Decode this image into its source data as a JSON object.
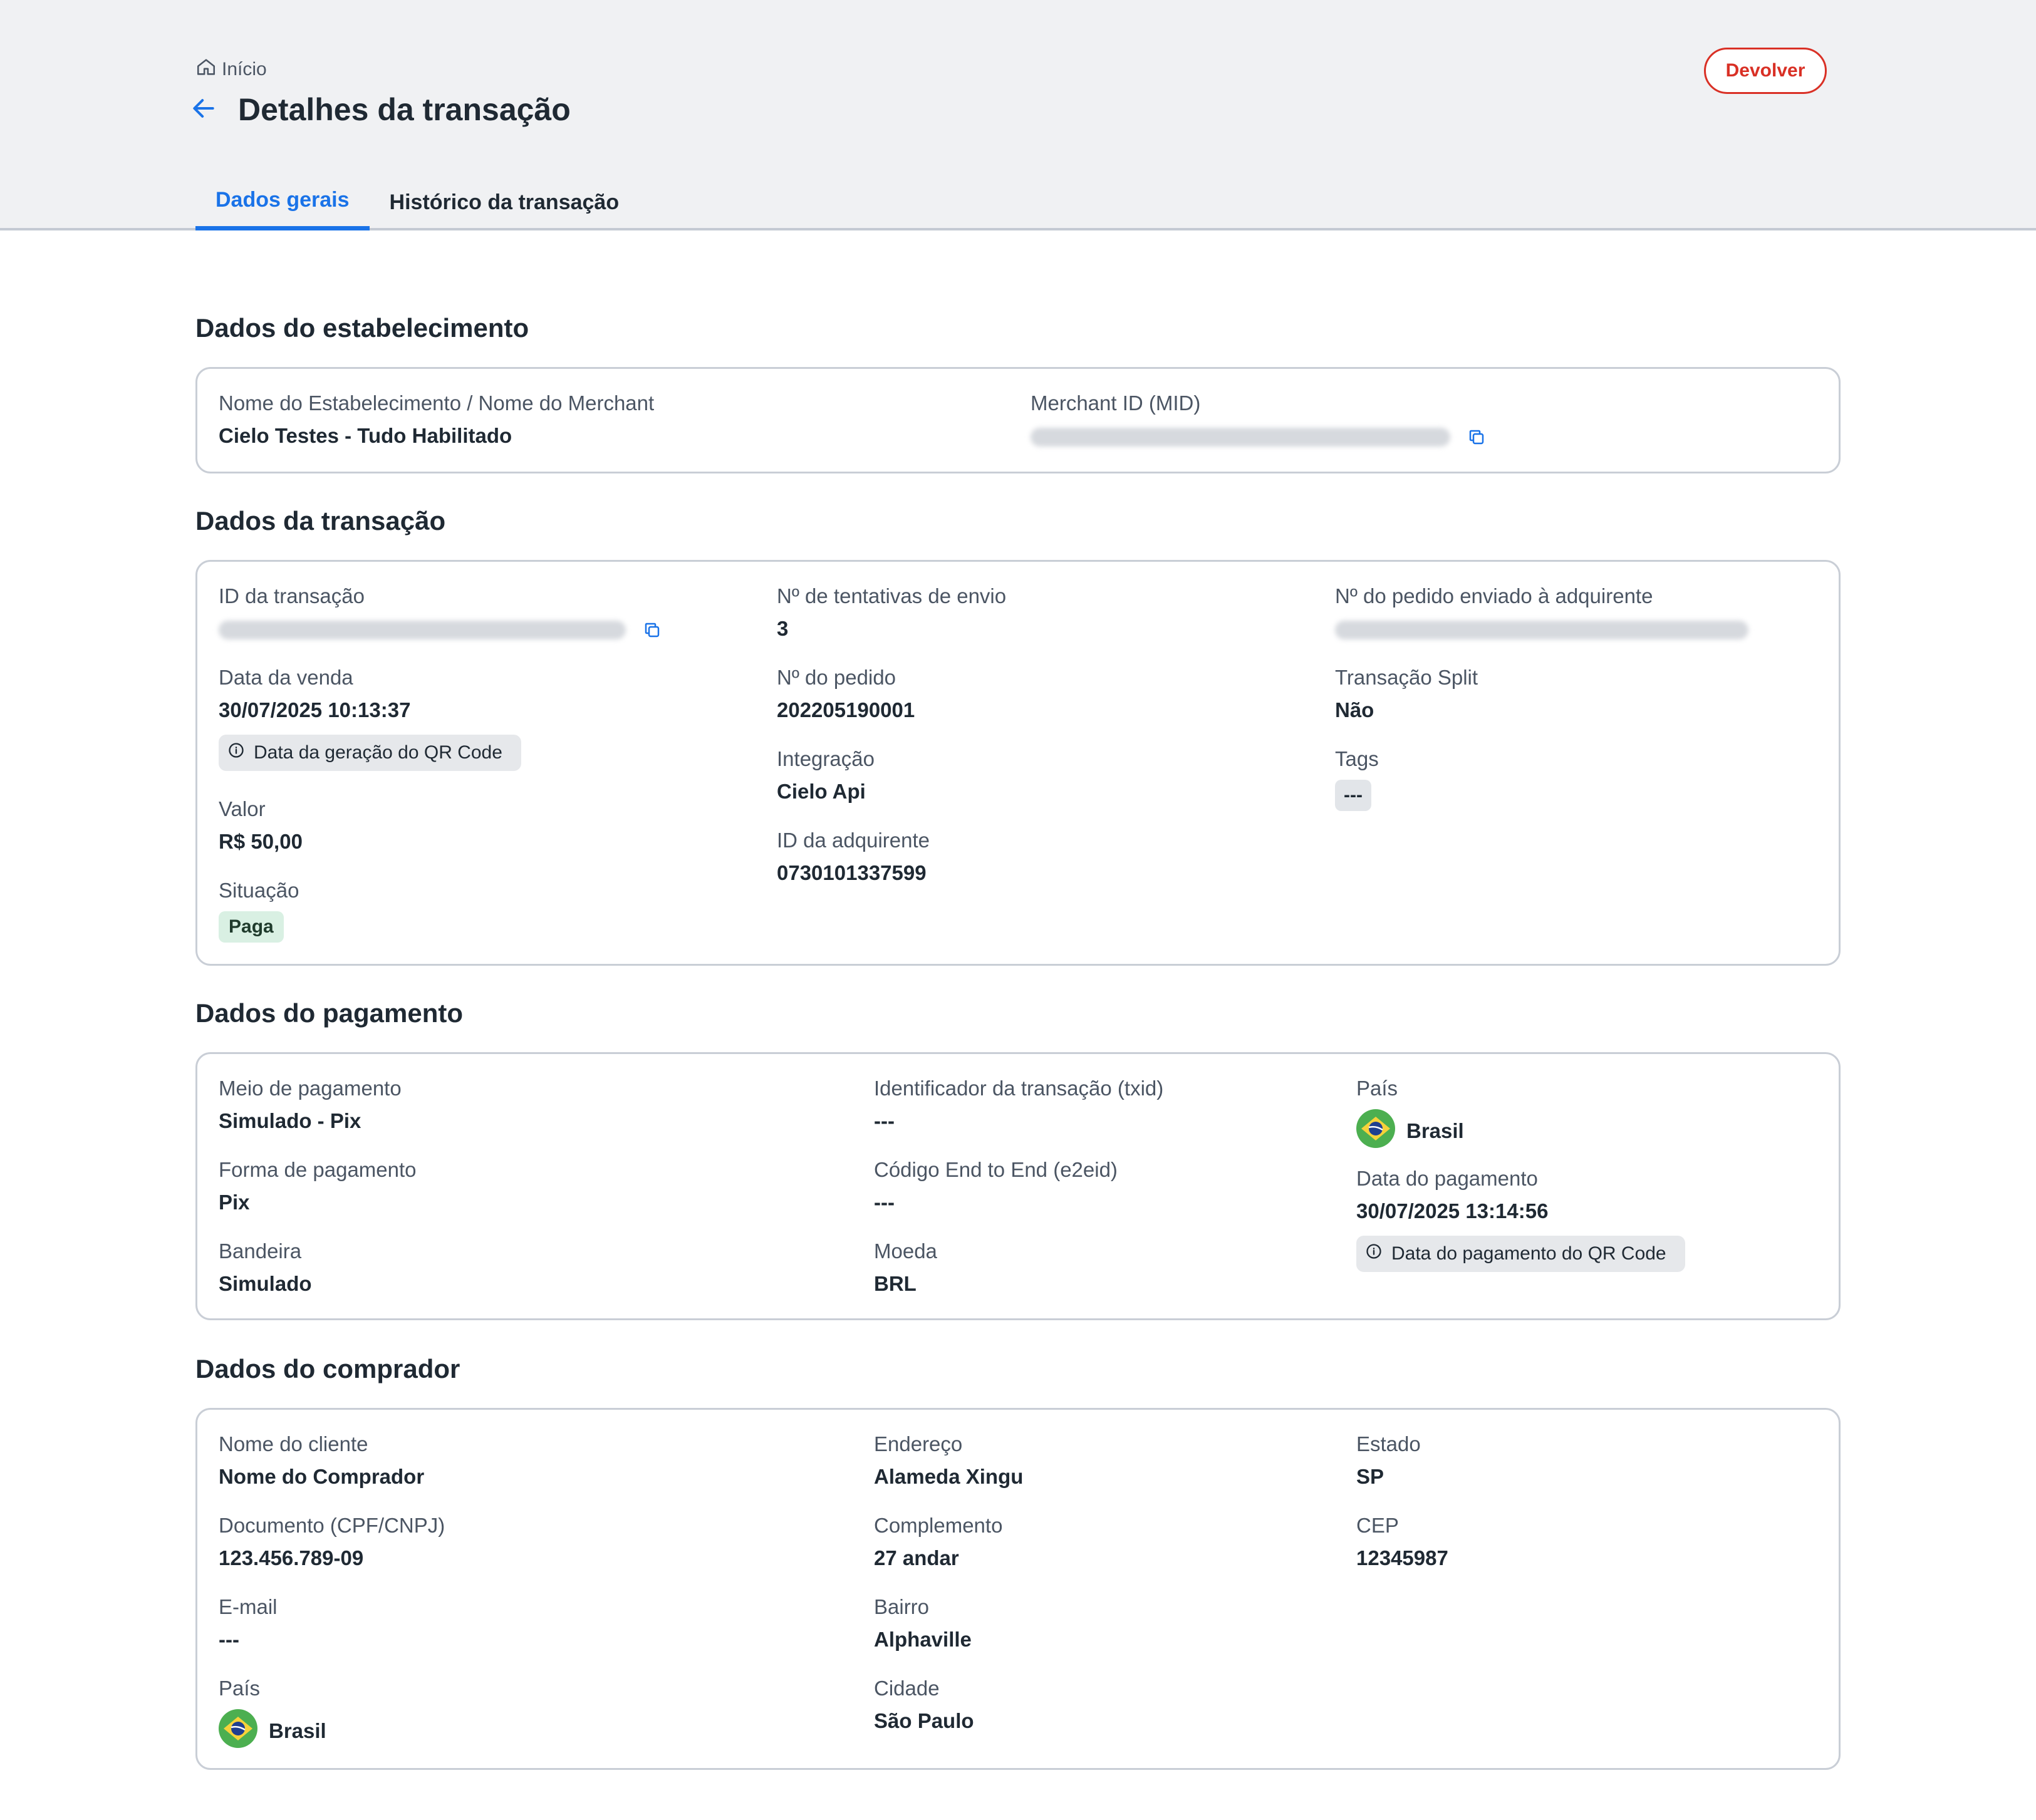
{
  "header": {
    "breadcrumb": "Início",
    "title": "Detalhes da transação",
    "devolver_label": "Devolver"
  },
  "tabs": [
    {
      "label": "Dados gerais",
      "active": true
    },
    {
      "label": "Histórico da transação",
      "active": false
    }
  ],
  "establishment": {
    "section_title": "Dados do estabelecimento",
    "name_label": "Nome do Estabelecimento / Nome do Merchant",
    "name_value": "Cielo Testes - Tudo Habilitado",
    "mid_label": "Merchant ID (MID)"
  },
  "transaction": {
    "section_title": "Dados da transação",
    "id_label": "ID da transação",
    "date_label": "Data da venda",
    "date_value": "30/07/2025 10:13:37",
    "date_chip": "Data da geração do QR Code",
    "valor_label": "Valor",
    "valor_value": "R$ 50,00",
    "situacao_label": "Situação",
    "situacao_value": "Paga",
    "tentativas_label": "Nº de tentativas de envio",
    "tentativas_value": "3",
    "pedido_label": "Nº do pedido",
    "pedido_value": "202205190001",
    "integracao_label": "Integração",
    "integracao_value": "Cielo Api",
    "adquirente_id_label": "ID da adquirente",
    "adquirente_id_value": "0730101337599",
    "pedido_adquirente_label": "Nº do pedido enviado à adquirente",
    "split_label": "Transação Split",
    "split_value": "Não",
    "tags_label": "Tags",
    "tags_value": "---"
  },
  "payment": {
    "section_title": "Dados do pagamento",
    "meio_label": "Meio de pagamento",
    "meio_value": "Simulado - Pix",
    "forma_label": "Forma de pagamento",
    "forma_value": "Pix",
    "bandeira_label": "Bandeira",
    "bandeira_value": "Simulado",
    "txid_label": "Identificador da transação (txid)",
    "txid_value": "---",
    "e2eid_label": "Código End to End (e2eid)",
    "e2eid_value": "---",
    "moeda_label": "Moeda",
    "moeda_value": "BRL",
    "pais_label": "País",
    "pais_value": "Brasil",
    "data_label": "Data do pagamento",
    "data_value": "30/07/2025 13:14:56",
    "data_chip": "Data do pagamento do QR Code"
  },
  "buyer": {
    "section_title": "Dados do comprador",
    "nome_label": "Nome do cliente",
    "nome_value": "Nome do Comprador",
    "documento_label": "Documento (CPF/CNPJ)",
    "documento_value": "123.456.789-09",
    "email_label": "E-mail",
    "email_value": "---",
    "pais_label": "País",
    "pais_value": "Brasil",
    "endereco_label": "Endereço",
    "endereco_value": "Alameda Xingu",
    "complemento_label": "Complemento",
    "complemento_value": "27 andar",
    "bairro_label": "Bairro",
    "bairro_value": "Alphaville",
    "cidade_label": "Cidade",
    "cidade_value": "São Paulo",
    "estado_label": "Estado",
    "estado_value": "SP",
    "cep_label": "CEP",
    "cep_value": "12345987"
  },
  "colors": {
    "accent": "#1a73e8",
    "danger": "#d93025",
    "header_bg": "#f0f1f3",
    "status_paid_bg": "#d9f0e3"
  },
  "icons": [
    "home-icon",
    "back-arrow-icon",
    "copy-icon",
    "info-icon",
    "brazil-flag-icon"
  ]
}
